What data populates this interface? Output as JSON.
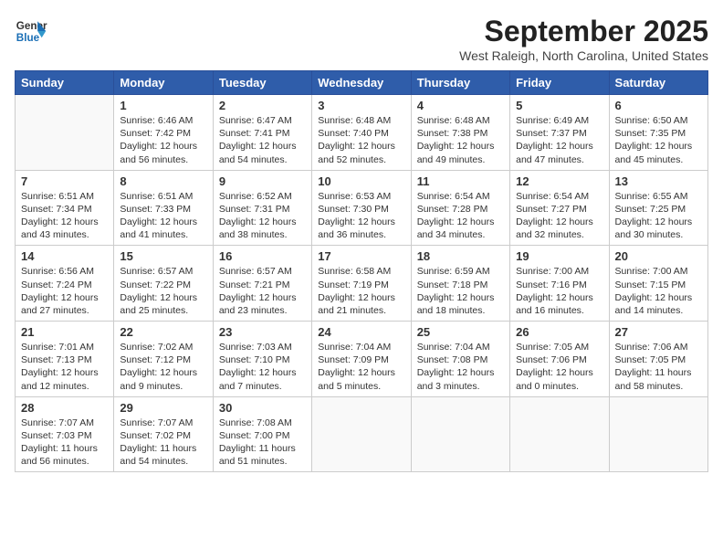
{
  "header": {
    "logo": {
      "line1": "General",
      "line2": "Blue"
    },
    "month_year": "September 2025",
    "location": "West Raleigh, North Carolina, United States"
  },
  "weekdays": [
    "Sunday",
    "Monday",
    "Tuesday",
    "Wednesday",
    "Thursday",
    "Friday",
    "Saturday"
  ],
  "weeks": [
    [
      {
        "day": "",
        "info": ""
      },
      {
        "day": "1",
        "info": "Sunrise: 6:46 AM\nSunset: 7:42 PM\nDaylight: 12 hours\nand 56 minutes."
      },
      {
        "day": "2",
        "info": "Sunrise: 6:47 AM\nSunset: 7:41 PM\nDaylight: 12 hours\nand 54 minutes."
      },
      {
        "day": "3",
        "info": "Sunrise: 6:48 AM\nSunset: 7:40 PM\nDaylight: 12 hours\nand 52 minutes."
      },
      {
        "day": "4",
        "info": "Sunrise: 6:48 AM\nSunset: 7:38 PM\nDaylight: 12 hours\nand 49 minutes."
      },
      {
        "day": "5",
        "info": "Sunrise: 6:49 AM\nSunset: 7:37 PM\nDaylight: 12 hours\nand 47 minutes."
      },
      {
        "day": "6",
        "info": "Sunrise: 6:50 AM\nSunset: 7:35 PM\nDaylight: 12 hours\nand 45 minutes."
      }
    ],
    [
      {
        "day": "7",
        "info": "Sunrise: 6:51 AM\nSunset: 7:34 PM\nDaylight: 12 hours\nand 43 minutes."
      },
      {
        "day": "8",
        "info": "Sunrise: 6:51 AM\nSunset: 7:33 PM\nDaylight: 12 hours\nand 41 minutes."
      },
      {
        "day": "9",
        "info": "Sunrise: 6:52 AM\nSunset: 7:31 PM\nDaylight: 12 hours\nand 38 minutes."
      },
      {
        "day": "10",
        "info": "Sunrise: 6:53 AM\nSunset: 7:30 PM\nDaylight: 12 hours\nand 36 minutes."
      },
      {
        "day": "11",
        "info": "Sunrise: 6:54 AM\nSunset: 7:28 PM\nDaylight: 12 hours\nand 34 minutes."
      },
      {
        "day": "12",
        "info": "Sunrise: 6:54 AM\nSunset: 7:27 PM\nDaylight: 12 hours\nand 32 minutes."
      },
      {
        "day": "13",
        "info": "Sunrise: 6:55 AM\nSunset: 7:25 PM\nDaylight: 12 hours\nand 30 minutes."
      }
    ],
    [
      {
        "day": "14",
        "info": "Sunrise: 6:56 AM\nSunset: 7:24 PM\nDaylight: 12 hours\nand 27 minutes."
      },
      {
        "day": "15",
        "info": "Sunrise: 6:57 AM\nSunset: 7:22 PM\nDaylight: 12 hours\nand 25 minutes."
      },
      {
        "day": "16",
        "info": "Sunrise: 6:57 AM\nSunset: 7:21 PM\nDaylight: 12 hours\nand 23 minutes."
      },
      {
        "day": "17",
        "info": "Sunrise: 6:58 AM\nSunset: 7:19 PM\nDaylight: 12 hours\nand 21 minutes."
      },
      {
        "day": "18",
        "info": "Sunrise: 6:59 AM\nSunset: 7:18 PM\nDaylight: 12 hours\nand 18 minutes."
      },
      {
        "day": "19",
        "info": "Sunrise: 7:00 AM\nSunset: 7:16 PM\nDaylight: 12 hours\nand 16 minutes."
      },
      {
        "day": "20",
        "info": "Sunrise: 7:00 AM\nSunset: 7:15 PM\nDaylight: 12 hours\nand 14 minutes."
      }
    ],
    [
      {
        "day": "21",
        "info": "Sunrise: 7:01 AM\nSunset: 7:13 PM\nDaylight: 12 hours\nand 12 minutes."
      },
      {
        "day": "22",
        "info": "Sunrise: 7:02 AM\nSunset: 7:12 PM\nDaylight: 12 hours\nand 9 minutes."
      },
      {
        "day": "23",
        "info": "Sunrise: 7:03 AM\nSunset: 7:10 PM\nDaylight: 12 hours\nand 7 minutes."
      },
      {
        "day": "24",
        "info": "Sunrise: 7:04 AM\nSunset: 7:09 PM\nDaylight: 12 hours\nand 5 minutes."
      },
      {
        "day": "25",
        "info": "Sunrise: 7:04 AM\nSunset: 7:08 PM\nDaylight: 12 hours\nand 3 minutes."
      },
      {
        "day": "26",
        "info": "Sunrise: 7:05 AM\nSunset: 7:06 PM\nDaylight: 12 hours\nand 0 minutes."
      },
      {
        "day": "27",
        "info": "Sunrise: 7:06 AM\nSunset: 7:05 PM\nDaylight: 11 hours\nand 58 minutes."
      }
    ],
    [
      {
        "day": "28",
        "info": "Sunrise: 7:07 AM\nSunset: 7:03 PM\nDaylight: 11 hours\nand 56 minutes."
      },
      {
        "day": "29",
        "info": "Sunrise: 7:07 AM\nSunset: 7:02 PM\nDaylight: 11 hours\nand 54 minutes."
      },
      {
        "day": "30",
        "info": "Sunrise: 7:08 AM\nSunset: 7:00 PM\nDaylight: 11 hours\nand 51 minutes."
      },
      {
        "day": "",
        "info": ""
      },
      {
        "day": "",
        "info": ""
      },
      {
        "day": "",
        "info": ""
      },
      {
        "day": "",
        "info": ""
      }
    ]
  ]
}
